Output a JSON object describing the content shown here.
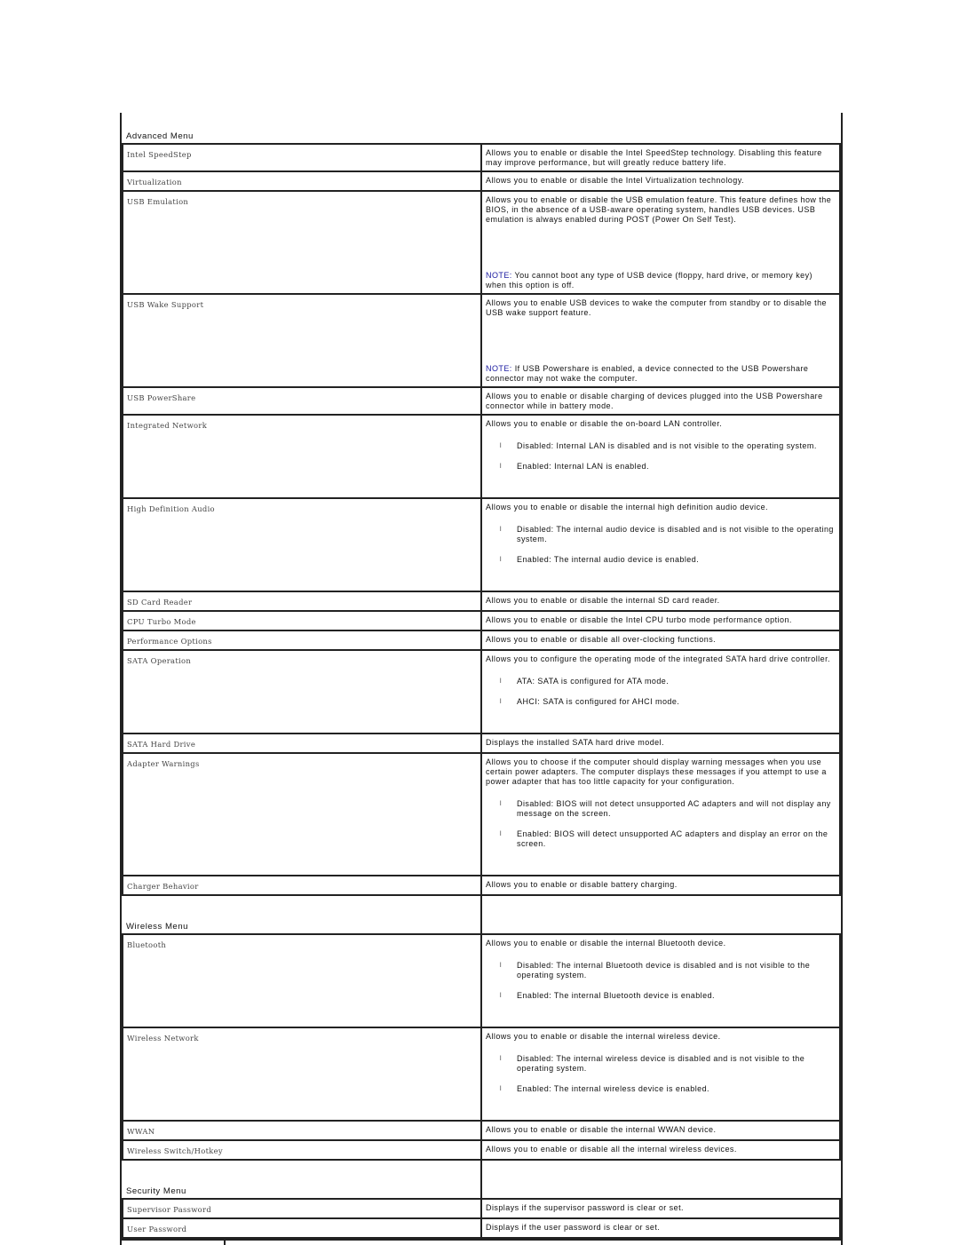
{
  "sections": [
    {
      "title": "Advanced Menu",
      "rows": [
        {
          "label": "Intel SpeedStep",
          "desc": "Allows you to enable or disable the Intel SpeedStep technology. Disabling this feature may improve performance, but will greatly reduce battery life."
        },
        {
          "label": "Virtualization",
          "desc": "Allows you to enable or disable the Intel Virtualization technology."
        },
        {
          "label": "USB Emulation",
          "desc": "Allows you to enable or disable the USB emulation feature. This feature defines how the BIOS, in the absence of a USB-aware operating system, handles USB devices. USB emulation is always enabled during POST (Power On Self Test).",
          "note_label": "NOTE:",
          "note_text": " You cannot boot any type of USB device (floppy, hard drive, or memory key) when this option is off."
        },
        {
          "label": "USB Wake Support",
          "desc": "Allows you to enable USB devices to wake the computer from standby or to disable the USB wake support feature.",
          "note_label": "NOTE:",
          "note_text": " If USB Powershare is enabled, a device connected to the USB Powershare connector may not wake the computer."
        },
        {
          "label": "USB PowerShare",
          "desc": "Allows you to enable or disable charging of devices plugged into the USB Powershare connector while in battery mode."
        },
        {
          "label": "Integrated Network",
          "desc": "Allows you to enable or disable the on-board LAN controller.",
          "options": [
            "Disabled: Internal LAN is disabled and is not visible to the operating system.",
            "Enabled: Internal LAN is enabled."
          ]
        },
        {
          "label": "High Definition Audio",
          "desc": "Allows you to enable or disable the internal high definition audio device.",
          "options": [
            "Disabled: The internal audio device is disabled and is not visible to the operating system.",
            "Enabled: The internal audio device is enabled."
          ]
        },
        {
          "label": "SD Card Reader",
          "desc": "Allows you to enable or disable the internal SD card reader."
        },
        {
          "label": "CPU Turbo Mode",
          "desc": "Allows you to enable or disable the Intel CPU turbo mode performance option."
        },
        {
          "label": "Performance Options",
          "desc": "Allows you to enable or disable all over-clocking functions."
        },
        {
          "label": "SATA Operation",
          "desc": "Allows you to configure the operating mode of the integrated SATA hard drive controller.",
          "options": [
            "ATA: SATA is configured for ATA mode.",
            "AHCI: SATA is configured for AHCI mode."
          ]
        },
        {
          "label": "SATA Hard Drive",
          "desc": "Displays the installed SATA hard drive model."
        },
        {
          "label": "Adapter Warnings",
          "desc": "Allows you to choose if the computer should display warning messages when you use certain power adapters. The computer displays these messages if you attempt to use a power adapter that has too little capacity for your configuration.",
          "options": [
            "Disabled: BIOS will not detect unsupported AC adapters and will not display any message on the screen.",
            "Enabled: BIOS will detect unsupported AC adapters and display an error on the screen."
          ]
        },
        {
          "label": "Charger Behavior",
          "desc": "Allows you to enable or disable battery charging."
        }
      ]
    },
    {
      "title": "Wireless Menu",
      "rows": [
        {
          "label": "Bluetooth",
          "desc": "Allows you to enable or disable the internal Bluetooth device.",
          "options": [
            "Disabled: The internal Bluetooth device is disabled and is not visible to the operating system.",
            "Enabled: The internal Bluetooth device is enabled."
          ]
        },
        {
          "label": "Wireless Network",
          "desc": "Allows you to enable or disable the internal wireless device.",
          "options": [
            "Disabled: The internal wireless device is disabled and is not visible to the operating system.",
            "Enabled: The internal wireless device is enabled."
          ]
        },
        {
          "label": "WWAN",
          "desc": "Allows you to enable or disable the internal WWAN device."
        },
        {
          "label": "Wireless Switch/Hotkey",
          "desc": "Allows you to enable or disable all the internal wireless devices."
        }
      ]
    },
    {
      "title": "Security Menu",
      "rows": [
        {
          "label": "Supervisor Password",
          "desc": "Displays if the supervisor password is clear or set."
        },
        {
          "label": "User Password",
          "desc": "Displays if the user password is clear or set."
        }
      ]
    }
  ],
  "bullet_glyph": "l"
}
